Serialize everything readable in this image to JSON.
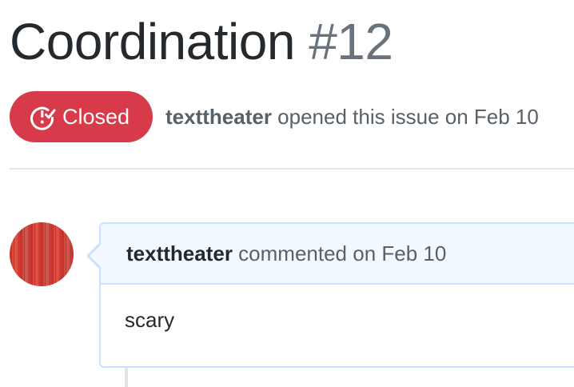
{
  "issue": {
    "title": "Coordination",
    "number": "#12",
    "state": "Closed",
    "author": "texttheater",
    "opened_text": "opened this issue on Feb 10"
  },
  "comment": {
    "author": "texttheater",
    "action_text": "commented on Feb 10",
    "body": "scary"
  },
  "colors": {
    "closed_badge": "#d73a49",
    "comment_header_bg": "#f1f8ff",
    "comment_border": "#c8e1ff",
    "muted_text": "#586069"
  },
  "icons": {
    "state": "issue-closed-icon"
  }
}
